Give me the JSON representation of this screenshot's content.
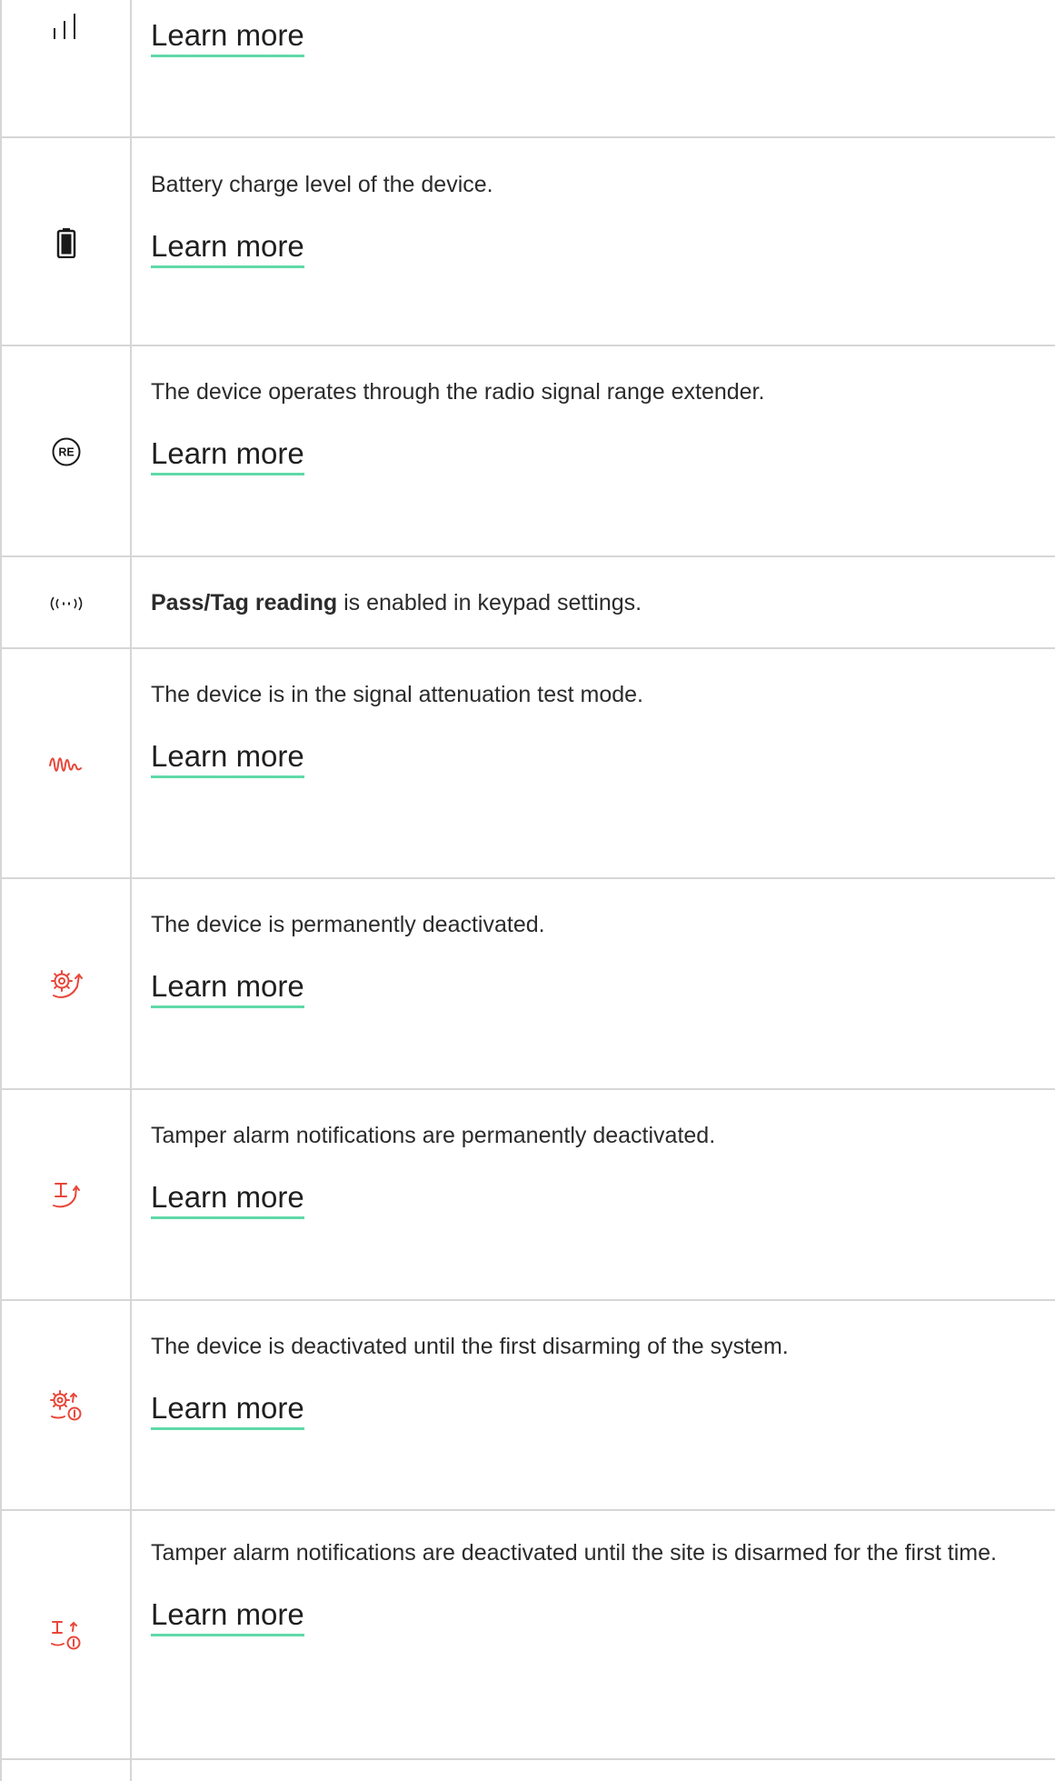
{
  "learn_more_label": "Learn more",
  "colors": {
    "link_underline": "#5fd9a8",
    "icon_dark": "#1a1a1a",
    "icon_red": "#e8473a",
    "grid_line": "#d6d6d6"
  },
  "rows": [
    {
      "icon": "signal-strength-icon",
      "description": "",
      "has_link": true
    },
    {
      "icon": "battery-icon",
      "description": "Battery charge level of the device.",
      "has_link": true
    },
    {
      "icon": "range-extender-icon",
      "description": "The device operates through the radio signal range extender.",
      "has_link": true
    },
    {
      "icon": "pass-tag-reading-icon",
      "description_bold": "Pass/Tag reading",
      "description": " is enabled in keypad settings.",
      "has_link": false
    },
    {
      "icon": "attenuation-test-icon",
      "description": "The device is in the signal attenuation test mode.",
      "has_link": true
    },
    {
      "icon": "permanently-deactivated-icon",
      "description": "The device is permanently deactivated.",
      "has_link": true
    },
    {
      "icon": "tamper-permanently-deactivated-icon",
      "description": "Tamper alarm notifications are permanently deactivated.",
      "has_link": true
    },
    {
      "icon": "deactivated-until-disarm-icon",
      "description": "The device is deactivated until the first disarming of the system.",
      "has_link": true
    },
    {
      "icon": "tamper-deactivated-until-disarm-icon",
      "description": "Tamper alarm notifications are deactivated until the site is disarmed for the first time.",
      "has_link": true
    }
  ]
}
